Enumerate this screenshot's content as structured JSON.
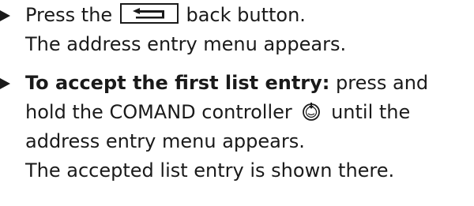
{
  "steps": [
    {
      "line1_before": "Press the",
      "line1_after": "back button.",
      "line2": "The address entry menu appears."
    },
    {
      "line1_bold": "To accept the first list entry:",
      "line1_rest": " press and",
      "line2_before": "hold the COMAND controller",
      "line2_after": "until the",
      "line3": "address entry menu appears.",
      "line4": "The accepted list entry is shown there."
    }
  ],
  "icons": {
    "bullet": "triangle-bullet-icon",
    "back_button": "back-arrow-button-icon",
    "controller": "comand-controller-press-icon"
  }
}
